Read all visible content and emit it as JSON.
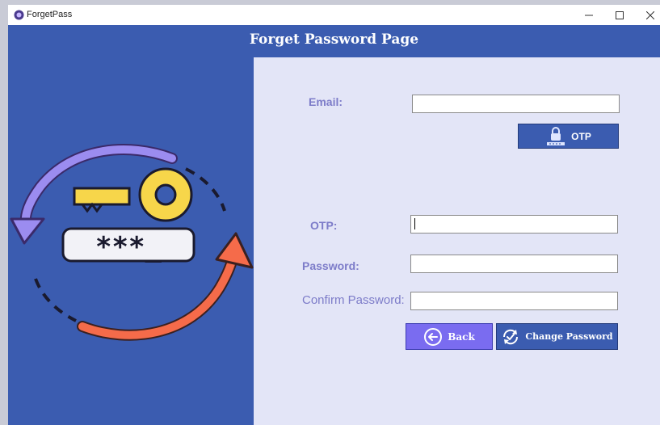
{
  "window": {
    "title": "ForgetPass"
  },
  "header": {
    "title": "Forget Password Page"
  },
  "form": {
    "email_label": "Email:",
    "email_value": "",
    "otp_button": "OTP",
    "otp_label": "OTP:",
    "otp_value": "",
    "password_label": "Password:",
    "password_value": "",
    "confirm_label": "Confirm Password:",
    "confirm_value": "",
    "back_button": "Back",
    "change_button": "Change Password"
  },
  "illustration": {
    "password_mask": "***_"
  },
  "colors": {
    "brand_blue": "#3b5cb0",
    "panel_bg": "#e3e5f7",
    "label_purple": "#7d7cc9",
    "back_button": "#7a6cf0",
    "arrow_purple": "#9b8cf0",
    "arrow_orange": "#f56b4a",
    "key_yellow": "#f7d64a"
  },
  "icons": {
    "app": "app-logo-icon",
    "minimize": "minimize-icon",
    "maximize": "maximize-icon",
    "close": "close-icon",
    "otp": "lock-otp-icon",
    "back": "back-arrow-icon",
    "change": "refresh-check-icon"
  }
}
